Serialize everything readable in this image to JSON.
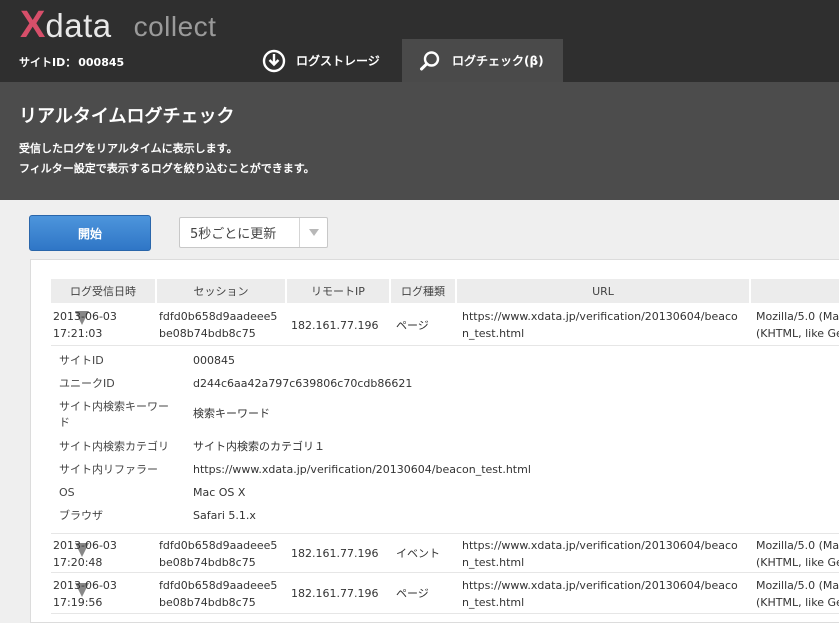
{
  "header": {
    "logo": {
      "x": "X",
      "data": "data",
      "collect": "collect"
    },
    "site_id_label": "サイトID：",
    "site_id_value": "000845",
    "tabs": [
      {
        "label": "ログストレージ",
        "icon": "download-icon"
      },
      {
        "label": "ログチェック(β)",
        "icon": "search-icon",
        "active": true
      }
    ]
  },
  "page": {
    "title": "リアルタイムログチェック",
    "desc_line1": "受信したログをリアルタイムに表示します。",
    "desc_line2": "フィルター設定で表示するログを絞り込むことができます。"
  },
  "controls": {
    "start_label": "開始",
    "refresh_value": "5秒ごとに更新"
  },
  "table": {
    "headers": [
      "ログ受信日時",
      "セッション",
      "リモートIP",
      "ログ種類",
      "URL"
    ],
    "rows": [
      {
        "date": "2013-06-03",
        "time": "17:21:03",
        "session1": "fdfd0b658d9aadeee5",
        "session2": "be08b74bdb8c75",
        "ip": "182.161.77.196",
        "type": "ページ",
        "url1": "https://www.xdata.jp/verification/20130604/beaco",
        "url2": "n_test.html",
        "ua1": "Mozilla/5.0 (Ma",
        "ua2": "(KHTML, like Ge"
      },
      {
        "date": "2013-06-03",
        "time": "17:20:48",
        "session1": "fdfd0b658d9aadeee5",
        "session2": "be08b74bdb8c75",
        "ip": "182.161.77.196",
        "type": "イベント",
        "url1": "https://www.xdata.jp/verification/20130604/beaco",
        "url2": "n_test.html",
        "ua1": "Mozilla/5.0 (Ma",
        "ua2": "(KHTML, like Ge"
      },
      {
        "date": "2013-06-03",
        "time": "17:19:56",
        "session1": "fdfd0b658d9aadeee5",
        "session2": "be08b74bdb8c75",
        "ip": "182.161.77.196",
        "type": "ページ",
        "url1": "https://www.xdata.jp/verification/20130604/beaco",
        "url2": "n_test.html",
        "ua1": "Mozilla/5.0 (Ma",
        "ua2": "(KHTML, like Ge"
      }
    ],
    "detail": [
      {
        "label": "サイトID",
        "value": "000845"
      },
      {
        "label": "ユニークID",
        "value": "d244c6aa42a797c639806c70cdb86621"
      },
      {
        "label1": "サイト内検索キーワー",
        "label2": "ド",
        "value": "検索キーワード"
      },
      {
        "label": "サイト内検索カテゴリ",
        "value": "サイト内検索のカテゴリ１"
      },
      {
        "label": "サイト内リファラー",
        "value": "https://www.xdata.jp/verification/20130604/beacon_test.html"
      },
      {
        "label": "OS",
        "value": "Mac OS X"
      },
      {
        "label": "ブラウザ",
        "value": "Safari 5.1.x"
      }
    ]
  },
  "colors": {
    "header_bg": "#2f2f2f",
    "title_bg": "#4c4c4c",
    "accent_blue": "#2f76c6",
    "logo_pink": "#d74f6a"
  }
}
